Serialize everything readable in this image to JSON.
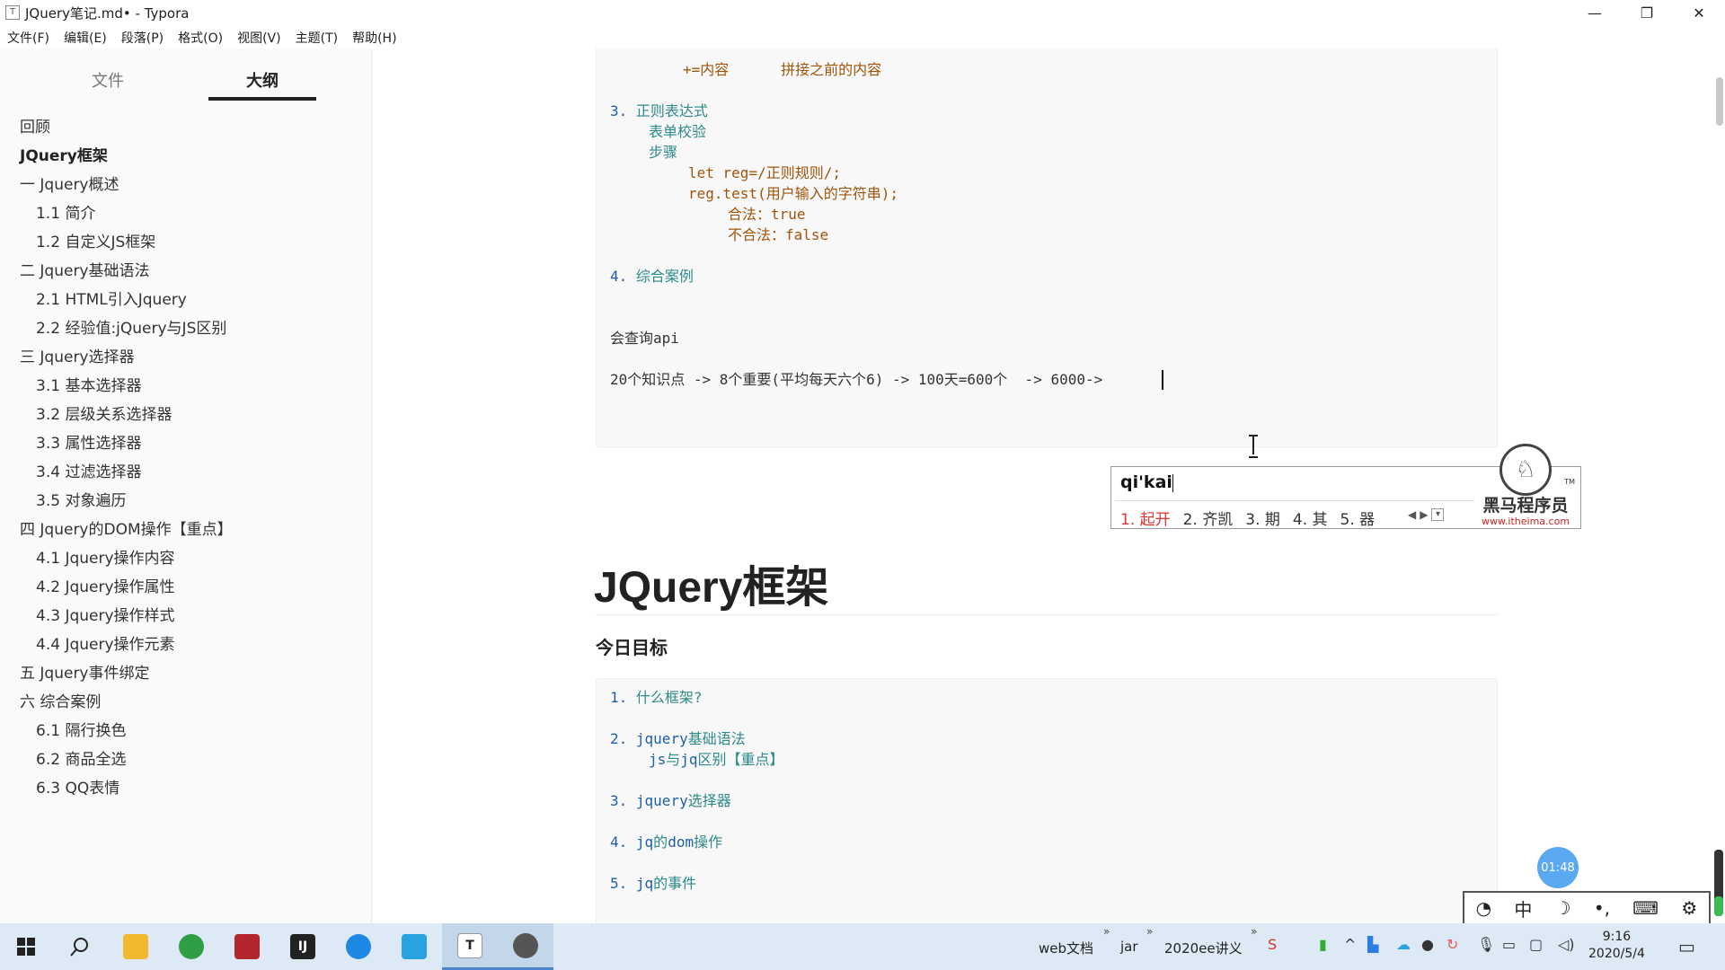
{
  "window": {
    "title": "JQuery笔记.md• - Typora",
    "app_icon": "T",
    "controls": [
      "—",
      "❐",
      "✕"
    ]
  },
  "menu": [
    "文件(F)",
    "编辑(E)",
    "段落(P)",
    "格式(O)",
    "视图(V)",
    "主题(T)",
    "帮助(H)"
  ],
  "sidebar": {
    "tabs": [
      "文件",
      "大纲"
    ],
    "active_tab": "大纲",
    "outline": [
      {
        "label": "回顾",
        "level": 1
      },
      {
        "label": "JQuery框架",
        "level": 0
      },
      {
        "label": "一 Jquery概述",
        "level": 2
      },
      {
        "label": "1.1 简介",
        "level": 3
      },
      {
        "label": "1.2 自定义JS框架",
        "level": 3
      },
      {
        "label": "二 Jquery基础语法",
        "level": 2
      },
      {
        "label": "2.1 HTML引入Jquery",
        "level": 3
      },
      {
        "label": "2.2 经验值:jQuery与JS区别",
        "level": 3
      },
      {
        "label": "三 Jquery选择器",
        "level": 2
      },
      {
        "label": "3.1 基本选择器",
        "level": 3
      },
      {
        "label": "3.2 层级关系选择器",
        "level": 3
      },
      {
        "label": "3.3 属性选择器",
        "level": 3
      },
      {
        "label": "3.4 过滤选择器",
        "level": 3
      },
      {
        "label": "3.5 对象遍历",
        "level": 3
      },
      {
        "label": "四 Jquery的DOM操作【重点】",
        "level": 2
      },
      {
        "label": "4.1 Jquery操作内容",
        "level": 3
      },
      {
        "label": "4.2 Jquery操作属性",
        "level": 3
      },
      {
        "label": "4.3 Jquery操作样式",
        "level": 3
      },
      {
        "label": "4.4 Jquery操作元素",
        "level": 3
      },
      {
        "label": "五 Jquery事件绑定",
        "level": 2
      },
      {
        "label": "六 综合案例",
        "level": 2
      },
      {
        "label": "6.1 隔行换色",
        "level": 3
      },
      {
        "label": "6.2 商品全选",
        "level": 3
      },
      {
        "label": "6.3 QQ表情",
        "level": 3
      }
    ],
    "footer": [
      "‹",
      "</>"
    ]
  },
  "editor": {
    "block1": {
      "l1_a": "+=",
      "l1_b": "内容",
      "l1_c": "拼接之前的内容",
      "l3_num": "3. ",
      "l3_text": "正则表达式",
      "l4": "表单校验",
      "l5": "步骤",
      "l6_a": "let reg=/",
      "l6_b": "正则规则",
      "l6_c": "/;",
      "l7_a": "reg.test(",
      "l7_b": "用户输入的字符串",
      "l7_c": ");",
      "l8_a": "合法：",
      "l8_b": "true",
      "l9_a": "不合法：",
      "l9_b": "false",
      "l11_num": "4. ",
      "l11_text": "综合案例",
      "l14_a": "会查询",
      "l14_b": "api",
      "l16": "20个知识点 -> 8个重要(平均每天六个6) -> 100天=600个  -> 6000->"
    },
    "heading1": "JQuery框架",
    "heading3": "今日目标",
    "block2": {
      "l1_num": "1. ",
      "l1_text": "什么框架?",
      "l3_num": "2. ",
      "l3_a": "jquery",
      "l3_b": "基础语法",
      "l4_a": "js",
      "l4_b": "与",
      "l4_c": "jq",
      "l4_d": "区别【重点】",
      "l6_num": "3. ",
      "l6_a": "jquery",
      "l6_b": "选择器",
      "l8_num": "4. ",
      "l8_a": "jq",
      "l8_b": "的",
      "l8_c": "dom",
      "l8_d": "操作",
      "l10_num": "5. ",
      "l10_a": "jq",
      "l10_b": "的事件"
    }
  },
  "ime": {
    "pinyin": "qi'kai",
    "candidates": [
      "1. 起开",
      "2. 齐凯",
      "3. 期",
      "4. 其",
      "5. 器"
    ],
    "logo_text": "黑马程序员",
    "logo_url": "www.itheima.com",
    "tm": "TM"
  },
  "timer": "01:48",
  "ime_toolbar": [
    "◔",
    "中",
    "☽",
    "•,",
    "⌨",
    "⚙"
  ],
  "taskbar": {
    "folders": [
      "web文档",
      "jar",
      "2020ee讲义"
    ],
    "clock_time": "9:16",
    "clock_date": "2020/5/4"
  }
}
